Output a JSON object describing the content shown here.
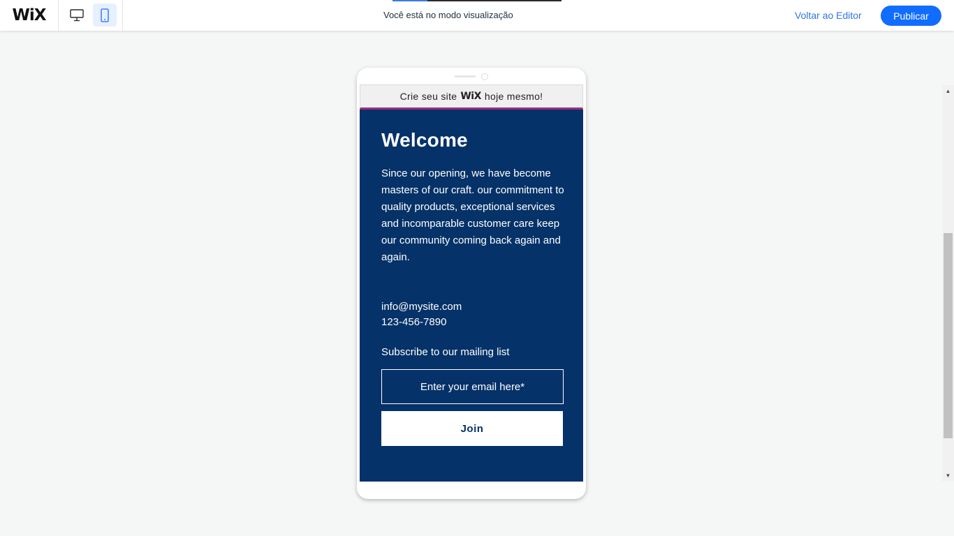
{
  "topbar": {
    "logo": "WiX",
    "desktop_icon": "desktop-monitor-icon",
    "mobile_icon": "mobile-phone-icon",
    "preview_mode_text": "Você está no modo visualização",
    "back_to_editor_label": "Voltar ao Editor",
    "publish_label": "Publicar"
  },
  "banner": {
    "text_before": "Crie seu site",
    "logo": "WiX",
    "text_after": "hoje mesmo!",
    "accent_color": "#9c2e7f"
  },
  "site": {
    "background_color": "#053268",
    "heading": "Welcome",
    "paragraph": "Since our opening, we have become masters of our craft. our commitment to quality products, exceptional services and incomparable customer care keep our community coming back again and again.",
    "email": "info@mysite.com",
    "phone": "123-456-7890",
    "subscribe_label": "Subscribe to our mailing list",
    "email_placeholder": "Enter your email here*",
    "join_label": "Join"
  },
  "colors": {
    "publish_button": "#116dff",
    "link": "#3373e0",
    "page_background": "#f5f6f6"
  }
}
